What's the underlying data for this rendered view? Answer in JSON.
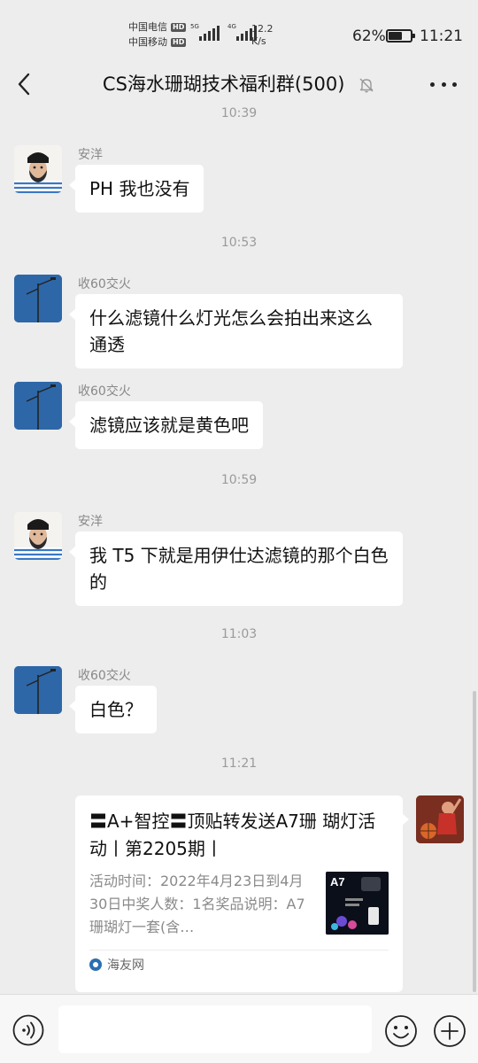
{
  "status_bar": {
    "carrier1": "中国电信",
    "carrier2": "中国移动",
    "hd": "HD",
    "net_5g": "5G",
    "net_4g": "4G",
    "speed_value": "12.2",
    "speed_unit": "K/s",
    "battery_percent": "62%",
    "battery_level": 0.62,
    "time": "11:21"
  },
  "header": {
    "title": "CS海水珊瑚技术福利群(500)"
  },
  "timestamps": [
    "10:39",
    "10:53",
    "10:59",
    "11:03",
    "11:21"
  ],
  "messages": [
    {
      "sender": "安洋",
      "text": "PH 我也没有"
    },
    {
      "sender": "收60交火",
      "text": "什么滤镜什么灯光怎么会拍出来这么通透"
    },
    {
      "sender": "收60交火",
      "text": "滤镜应该就是黄色吧"
    },
    {
      "sender": "安洋",
      "text": "我 T5 下就是用伊仕达滤镜的那个白色的"
    },
    {
      "sender": "收60交火",
      "text": "白色？"
    }
  ],
  "link_card": {
    "title": "〓A+智控〓顶贴转发送A7珊 瑚灯活动丨第2205期丨",
    "description": "活动时间：2022年4月23日到4月30日中奖人数：1名奖品说明：A7珊瑚灯一套(含…",
    "thumb_label": "A7",
    "source": "海友网"
  },
  "input": {
    "placeholder": ""
  },
  "colors": {
    "background": "#ededed",
    "bubble": "#ffffff",
    "avatar_blue": "#2e67a8"
  }
}
